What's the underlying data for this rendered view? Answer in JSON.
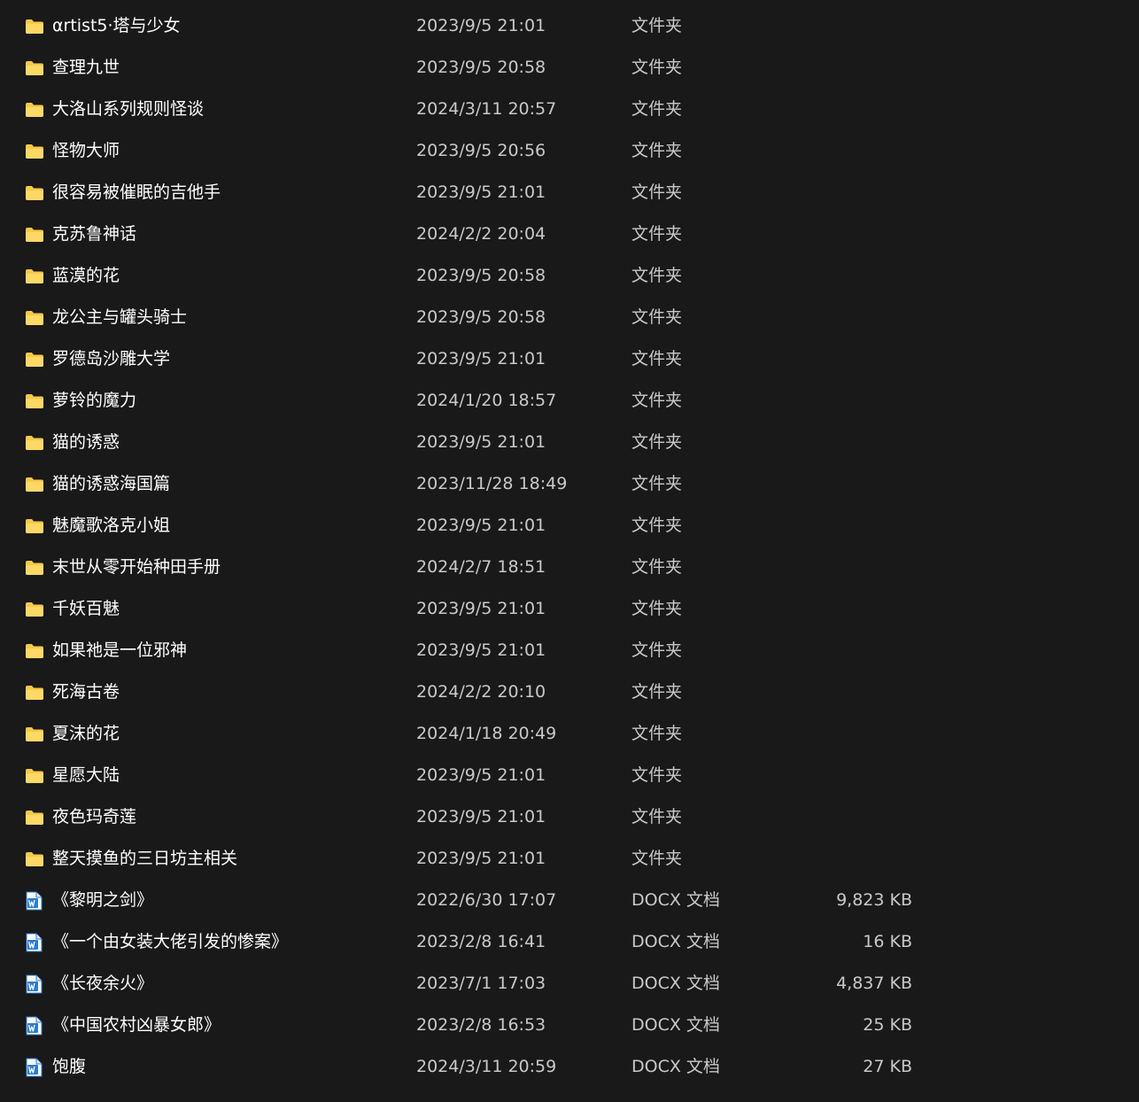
{
  "files": [
    {
      "name": "αrtist5·塔与少女",
      "date": "2023/9/5 21:01",
      "type": "文件夹",
      "size": "",
      "icon": "folder-icon"
    },
    {
      "name": "查理九世",
      "date": "2023/9/5 20:58",
      "type": "文件夹",
      "size": "",
      "icon": "folder-icon"
    },
    {
      "name": "大洛山系列规则怪谈",
      "date": "2024/3/11 20:57",
      "type": "文件夹",
      "size": "",
      "icon": "folder-icon"
    },
    {
      "name": "怪物大师",
      "date": "2023/9/5 20:56",
      "type": "文件夹",
      "size": "",
      "icon": "folder-icon"
    },
    {
      "name": "很容易被催眠的吉他手",
      "date": "2023/9/5 21:01",
      "type": "文件夹",
      "size": "",
      "icon": "folder-icon"
    },
    {
      "name": "克苏鲁神话",
      "date": "2024/2/2 20:04",
      "type": "文件夹",
      "size": "",
      "icon": "folder-icon"
    },
    {
      "name": "蓝漠的花",
      "date": "2023/9/5 20:58",
      "type": "文件夹",
      "size": "",
      "icon": "folder-icon"
    },
    {
      "name": "龙公主与罐头骑士",
      "date": "2023/9/5 20:58",
      "type": "文件夹",
      "size": "",
      "icon": "folder-icon"
    },
    {
      "name": "罗德岛沙雕大学",
      "date": "2023/9/5 21:01",
      "type": "文件夹",
      "size": "",
      "icon": "folder-icon"
    },
    {
      "name": "萝铃的魔力",
      "date": "2024/1/20 18:57",
      "type": "文件夹",
      "size": "",
      "icon": "folder-icon"
    },
    {
      "name": "猫的诱惑",
      "date": "2023/9/5 21:01",
      "type": "文件夹",
      "size": "",
      "icon": "folder-icon"
    },
    {
      "name": "猫的诱惑海国篇",
      "date": "2023/11/28 18:49",
      "type": "文件夹",
      "size": "",
      "icon": "folder-icon"
    },
    {
      "name": "魅魔歌洛克小姐",
      "date": "2023/9/5 21:01",
      "type": "文件夹",
      "size": "",
      "icon": "folder-icon"
    },
    {
      "name": "末世从零开始种田手册",
      "date": "2024/2/7 18:51",
      "type": "文件夹",
      "size": "",
      "icon": "folder-icon"
    },
    {
      "name": "千妖百魅",
      "date": "2023/9/5 21:01",
      "type": "文件夹",
      "size": "",
      "icon": "folder-icon"
    },
    {
      "name": "如果祂是一位邪神",
      "date": "2023/9/5 21:01",
      "type": "文件夹",
      "size": "",
      "icon": "folder-icon"
    },
    {
      "name": "死海古卷",
      "date": "2024/2/2 20:10",
      "type": "文件夹",
      "size": "",
      "icon": "folder-icon"
    },
    {
      "name": "夏沫的花",
      "date": "2024/1/18 20:49",
      "type": "文件夹",
      "size": "",
      "icon": "folder-icon"
    },
    {
      "name": "星愿大陆",
      "date": "2023/9/5 21:01",
      "type": "文件夹",
      "size": "",
      "icon": "folder-icon"
    },
    {
      "name": "夜色玛奇莲",
      "date": "2023/9/5 21:01",
      "type": "文件夹",
      "size": "",
      "icon": "folder-icon"
    },
    {
      "name": "整天摸鱼的三日坊主相关",
      "date": "2023/9/5 21:01",
      "type": "文件夹",
      "size": "",
      "icon": "folder-icon"
    },
    {
      "name": "《黎明之剑》",
      "date": "2022/6/30 17:07",
      "type": "DOCX 文档",
      "size": "9,823 KB",
      "icon": "word-doc-icon"
    },
    {
      "name": "《一个由女装大佬引发的惨案》",
      "date": "2023/2/8 16:41",
      "type": "DOCX 文档",
      "size": "16 KB",
      "icon": "word-doc-icon"
    },
    {
      "name": "《长夜余火》",
      "date": "2023/7/1 17:03",
      "type": "DOCX 文档",
      "size": "4,837 KB",
      "icon": "word-doc-icon"
    },
    {
      "name": "《中国农村凶暴女郎》",
      "date": "2023/2/8 16:53",
      "type": "DOCX 文档",
      "size": "25 KB",
      "icon": "word-doc-icon"
    },
    {
      "name": "饱腹",
      "date": "2024/3/11 20:59",
      "type": "DOCX 文档",
      "size": "27 KB",
      "icon": "word-doc-icon"
    }
  ],
  "colors": {
    "background": "#191919",
    "text_primary": "#ffffff",
    "text_secondary": "#c9c9c9",
    "folder": "#f7c948",
    "word_blue": "#2b7cd3"
  }
}
